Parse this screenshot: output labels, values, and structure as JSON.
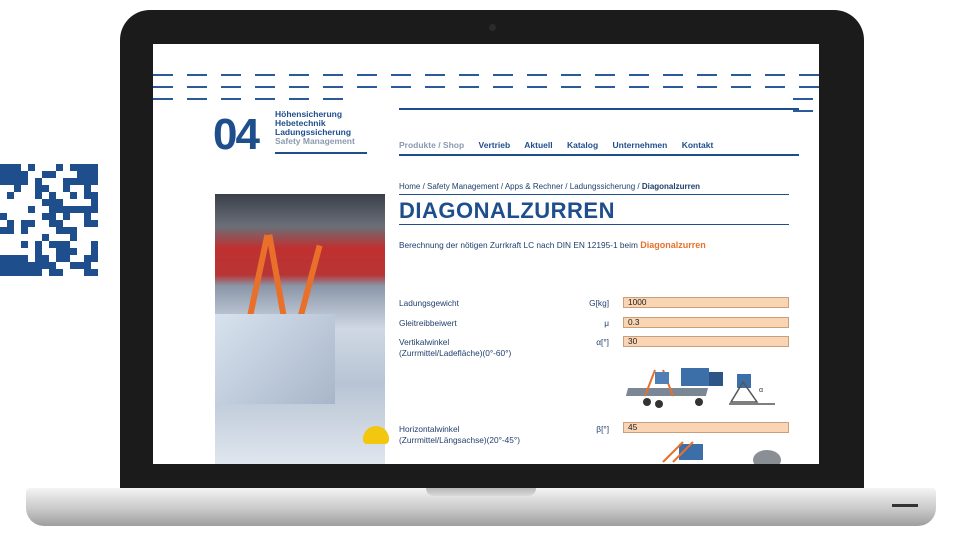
{
  "logo": {
    "number": "04",
    "lines": [
      "Höhensicherung",
      "Hebetechnik",
      "Ladungssicherung"
    ],
    "sub": "Safety Management"
  },
  "nav": {
    "items": [
      "Produkte / Shop",
      "Vertrieb",
      "Aktuell",
      "Katalog",
      "Unternehmen",
      "Kontakt"
    ]
  },
  "breadcrumb": {
    "path": "Home / Safety Management / Apps & Rechner / Ladungssicherung / ",
    "current": "Diagonalzurren"
  },
  "page": {
    "title": "DIAGONALZURREN",
    "description": "Berechnung der nötigen Zurrkraft LC nach DIN EN 12195-1 beim ",
    "description_highlight": "Diagonalzurren"
  },
  "form": {
    "rows": [
      {
        "label": "Ladungsgewicht",
        "unit": "G[kg]",
        "value": "1000"
      },
      {
        "label": "Gleitreibbeiwert",
        "unit": "μ",
        "value": "0.3"
      },
      {
        "label": "Vertikalwinkel",
        "label2": "(Zurrmittel/Ladefläche)(0°-60°)",
        "unit": "α[°]",
        "value": "30"
      },
      {
        "label": "Horizontalwinkel",
        "label2": "(Zurrmittel/Längsachse)(20°-45°)",
        "unit": "β[°]",
        "value": "45"
      }
    ]
  },
  "colors": {
    "brand_blue": "#1f4e8c",
    "input_bg": "#f9d5b3",
    "highlight_orange": "#e8702a"
  }
}
